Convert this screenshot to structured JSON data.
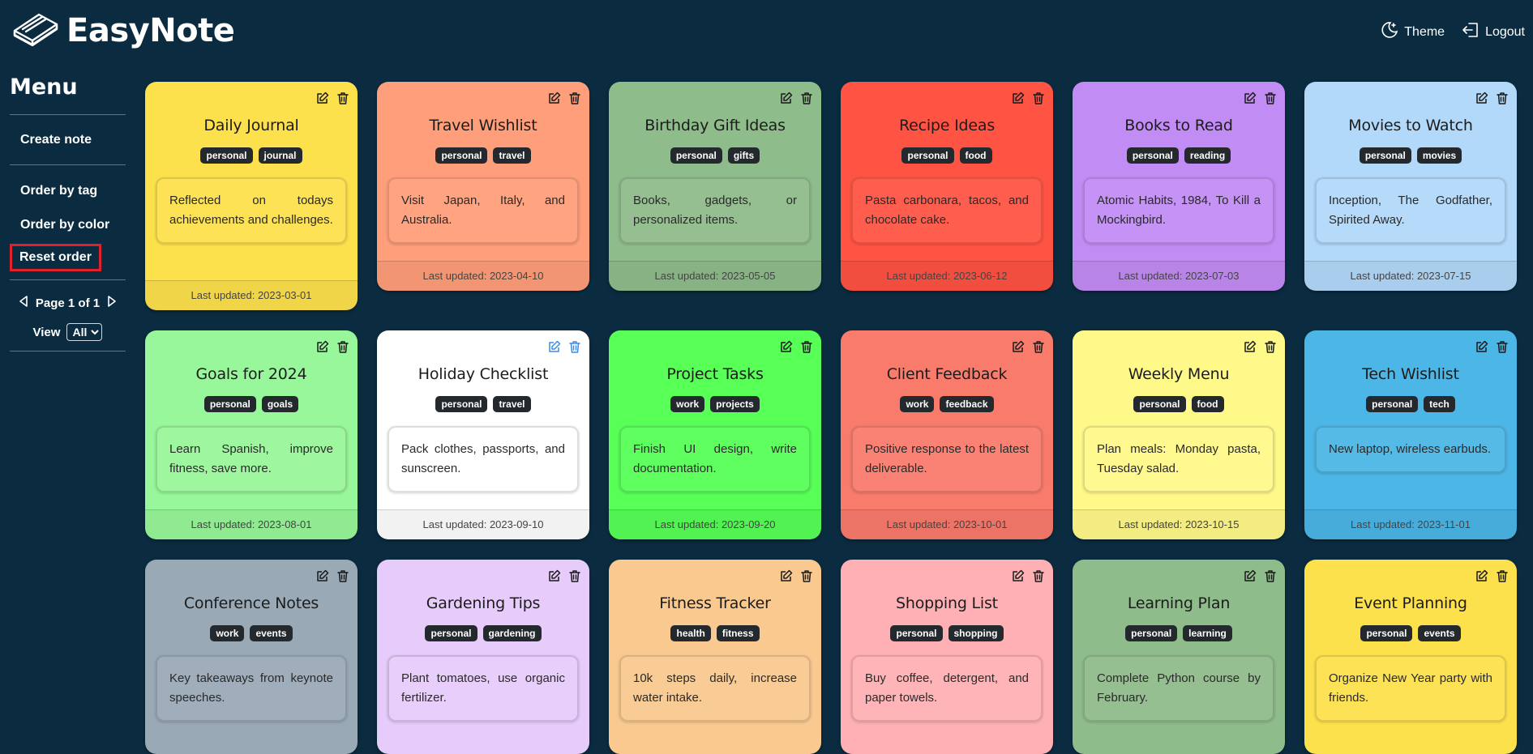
{
  "app": {
    "name": "EasyNote"
  },
  "header": {
    "theme_label": "Theme",
    "logout_label": "Logout"
  },
  "sidebar": {
    "title": "Menu",
    "create_note": "Create note",
    "order_by_tag": "Order by tag",
    "order_by_color": "Order by color",
    "reset_order": "Reset order",
    "page_label": "Page 1 of 1",
    "view_label": "View",
    "view_selected": "All"
  },
  "colors": {
    "background": "#0b2c40",
    "highlight": "#e0202a",
    "active_icon": "#3b8ce6"
  },
  "notes": [
    {
      "title": "Daily Journal",
      "tags": [
        "personal",
        "journal"
      ],
      "body": "Reflected on todays achievements and challenges.",
      "updated": "Last updated: 2023-03-01",
      "color": "#fde14c"
    },
    {
      "title": "Travel Wishlist",
      "tags": [
        "personal",
        "travel"
      ],
      "body": "Visit Japan, Italy, and Australia.",
      "updated": "Last updated: 2023-04-10",
      "color": "#ff9e7a"
    },
    {
      "title": "Birthday Gift Ideas",
      "tags": [
        "personal",
        "gifts"
      ],
      "body": "Books, gadgets, or personalized items.",
      "updated": "Last updated: 2023-05-05",
      "color": "#8fbc8b"
    },
    {
      "title": "Recipe Ideas",
      "tags": [
        "personal",
        "food"
      ],
      "body": "Pasta carbonara, tacos, and chocolate cake.",
      "updated": "Last updated: 2023-06-12",
      "color": "#ff5343"
    },
    {
      "title": "Books to Read",
      "tags": [
        "personal",
        "reading"
      ],
      "body": "Atomic Habits, 1984, To Kill a Mockingbird.",
      "updated": "Last updated: 2023-07-03",
      "color": "#c28cf5"
    },
    {
      "title": "Movies to Watch",
      "tags": [
        "personal",
        "movies"
      ],
      "body": "Inception, The Godfather, Spirited Away.",
      "updated": "Last updated: 2023-07-15",
      "color": "#b2d9fa"
    },
    {
      "title": "Goals for 2024",
      "tags": [
        "personal",
        "goals"
      ],
      "body": "Learn Spanish, improve fitness, save more.",
      "updated": "Last updated: 2023-08-01",
      "color": "#98f79a"
    },
    {
      "title": "Holiday Checklist",
      "tags": [
        "personal",
        "travel"
      ],
      "body": "Pack clothes, passports, and sunscreen.",
      "updated": "Last updated: 2023-09-10",
      "color": "#ffffff",
      "active_icons": true
    },
    {
      "title": "Project Tasks",
      "tags": [
        "work",
        "projects"
      ],
      "body": "Finish UI design, write documentation.",
      "updated": "Last updated: 2023-09-20",
      "color": "#57ff57"
    },
    {
      "title": "Client Feedback",
      "tags": [
        "work",
        "feedback"
      ],
      "body": "Positive response to the latest deliverable.",
      "updated": "Last updated: 2023-10-01",
      "color": "#f97b6c"
    },
    {
      "title": "Weekly Menu",
      "tags": [
        "personal",
        "food"
      ],
      "body": "Plan meals: Monday pasta, Tuesday salad.",
      "updated": "Last updated: 2023-10-15",
      "color": "#fff98a"
    },
    {
      "title": "Tech Wishlist",
      "tags": [
        "personal",
        "tech"
      ],
      "body": "New laptop, wireless earbuds.",
      "updated": "Last updated: 2023-11-01",
      "color": "#4cb6e6"
    },
    {
      "title": "Conference Notes",
      "tags": [
        "work",
        "events"
      ],
      "body": "Key takeaways from keynote speeches.",
      "updated": "",
      "color": "#9aa9b6"
    },
    {
      "title": "Gardening Tips",
      "tags": [
        "personal",
        "gardening"
      ],
      "body": "Plant tomatoes, use organic fertilizer.",
      "updated": "",
      "color": "#e6cbfb"
    },
    {
      "title": "Fitness Tracker",
      "tags": [
        "health",
        "fitness"
      ],
      "body": "10k steps daily, increase water intake.",
      "updated": "",
      "color": "#f9c98f"
    },
    {
      "title": "Shopping List",
      "tags": [
        "personal",
        "shopping"
      ],
      "body": "Buy coffee, detergent, and paper towels.",
      "updated": "",
      "color": "#ffb0b4"
    },
    {
      "title": "Learning Plan",
      "tags": [
        "personal",
        "learning"
      ],
      "body": "Complete Python course by February.",
      "updated": "",
      "color": "#8fbc8b"
    },
    {
      "title": "Event Planning",
      "tags": [
        "personal",
        "events"
      ],
      "body": "Organize New Year party with friends.",
      "updated": "",
      "color": "#fde14c"
    }
  ]
}
